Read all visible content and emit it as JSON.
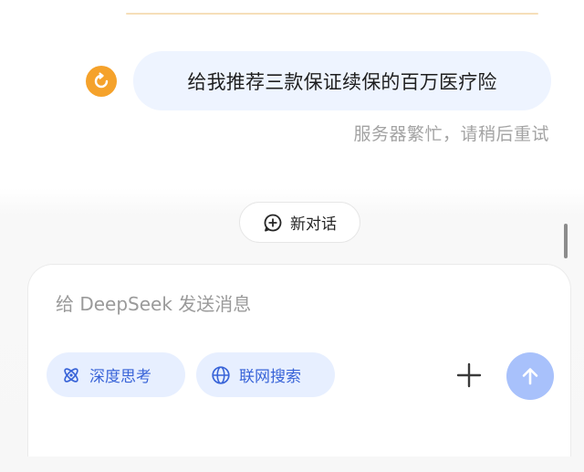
{
  "chat": {
    "user_message": "给我推荐三款保证续保的百万医疗险",
    "error_text": "服务器繁忙，请稍后重试",
    "retry_icon": "retry-icon",
    "new_chat_label": "新对话",
    "new_chat_icon": "chat-plus-icon"
  },
  "composer": {
    "placeholder": "给 DeepSeek 发送消息",
    "value": "",
    "deep_think_label": "深度思考",
    "deep_think_icon": "atom-icon",
    "web_search_label": "联网搜索",
    "web_search_icon": "globe-icon",
    "attach_icon": "plus-icon",
    "send_icon": "arrow-up-icon"
  },
  "colors": {
    "accent": "#3964d8",
    "chip_bg": "#e7efff",
    "user_bubble_bg": "#eef4ff",
    "retry_orange": "#f5a22b",
    "send_disabled": "#a8c1fb",
    "muted_text": "#a3a3a3"
  }
}
